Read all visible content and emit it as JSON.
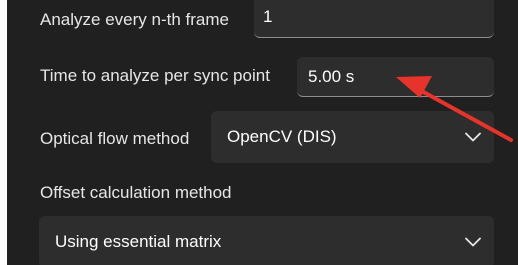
{
  "settings": {
    "nth_frame": {
      "label": "Analyze every n-th frame",
      "value": "1"
    },
    "time_per_sync": {
      "label": "Time to analyze per sync point",
      "value": "5.00 s"
    },
    "optical_flow": {
      "label": "Optical flow method",
      "selected": "OpenCV (DIS)"
    },
    "offset_calc": {
      "label": "Offset calculation method",
      "selected": "Using essential matrix"
    }
  },
  "icons": {
    "dropdown": "chevron-down-icon"
  },
  "colors": {
    "panel_bg": "#202020",
    "field_bg": "#2d2d2d",
    "text": "#e6e6e6",
    "annotation_arrow": "#e8332a"
  }
}
